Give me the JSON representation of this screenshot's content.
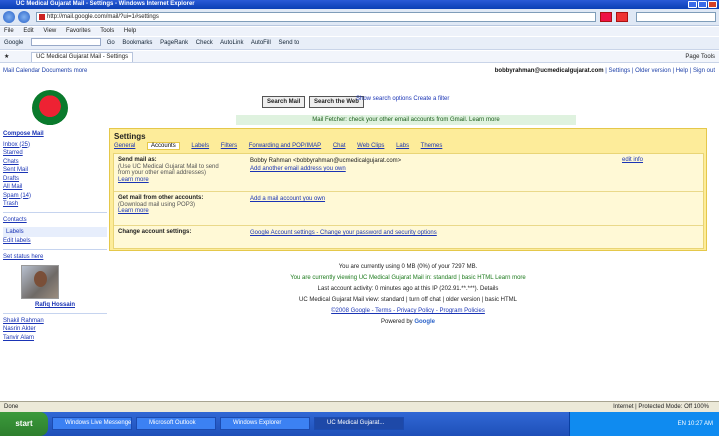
{
  "window": {
    "title": "UC Medical Gujarat Mail - Settings - Windows Internet Explorer"
  },
  "address_bar": {
    "url": "http://mail.google.com/mail/?ui=1#settings"
  },
  "menu": [
    "File",
    "Edit",
    "View",
    "Favorites",
    "Tools",
    "Help"
  ],
  "google_toolbar": {
    "label": "Google",
    "items": [
      "Go",
      "Bookmarks",
      "PageRank",
      "Check",
      "AutoLink",
      "AutoFill",
      "Send to"
    ]
  },
  "favorites_bar": {
    "tab": "UC Medical Gujarat Mail - Settings",
    "right": "Page  Tools"
  },
  "header": {
    "left": "Mail  Calendar  Documents  more",
    "user": "bobbyrahman@ucmedicalgujarat.com",
    "links": [
      "Settings",
      "Older version",
      "Help",
      "Sign out"
    ]
  },
  "top": {
    "search_mail": "Search Mail",
    "search_web": "Search the Web",
    "options": "Show search options  Create a filter"
  },
  "greenbar": "Mail Fetcher: check your other email accounts from Gmail.  Learn more",
  "sidebar": {
    "compose": "Compose Mail",
    "items": [
      "Inbox (25)",
      "Starred",
      "Chats",
      "Sent Mail",
      "Drafts",
      "All Mail",
      "Spam (14)",
      "Trash"
    ],
    "contacts": "Contacts",
    "labels": "Labels",
    "edit_labels": "Edit labels",
    "chat_status": "Set status here",
    "chat_name": "Rafiq Hossain",
    "contact_list": [
      "Shakil Rahman",
      "Nasrin Akter",
      "Tanvir Alam"
    ]
  },
  "settings": {
    "title": "Settings",
    "tabs": [
      "General",
      "Accounts",
      "Labels",
      "Filters",
      "Forwarding and POP/IMAP",
      "Chat",
      "Web Clips",
      "Labs",
      "Themes"
    ],
    "active_tab": "Accounts",
    "rows": [
      {
        "label": "Send mail as:",
        "desc": "(Use UC Medical Gujarat Mail to send from your other email addresses)",
        "more": "Learn more",
        "value": "Bobby Rahman <bobbyrahman@ucmedicalgujarat.com>",
        "link": "Add another email address you own",
        "action": "edit info"
      },
      {
        "label": "Get mail from other accounts:",
        "desc": "(Download mail using POP3)",
        "more": "Learn more",
        "link": "Add a mail account you own"
      },
      {
        "label": "Change account settings:",
        "value": "Google Account settings - Change your password and security options"
      }
    ]
  },
  "footer": {
    "line1": "You are currently using 0 MB (0%) of your 7297 MB.",
    "line2": "You are currently viewing UC Medical Gujarat Mail in: standard | basic HTML  Learn more",
    "line3": "Last account activity: 0 minutes ago at this IP (202.91.**.***).  Details",
    "line4": "UC Medical Gujarat Mail view: standard | turn off chat | older version | basic HTML",
    "line5": "©2008 Google - Terms - Privacy Policy - Program Policies",
    "powered": "Powered by",
    "brand": "Google"
  },
  "statusbar": {
    "left": "Done",
    "right": "Internet | Protected Mode: Off   100%"
  },
  "taskbar": {
    "start": "start",
    "tasks": [
      "Windows Live Messenger",
      "Microsoft Outlook",
      "Windows Explorer",
      "UC Medical Gujarat..."
    ],
    "clock": "EN  10:27 AM"
  },
  "colors": {
    "panel": "#fdec9a",
    "link": "#1a34b5",
    "taskbar": "#3168d5"
  }
}
